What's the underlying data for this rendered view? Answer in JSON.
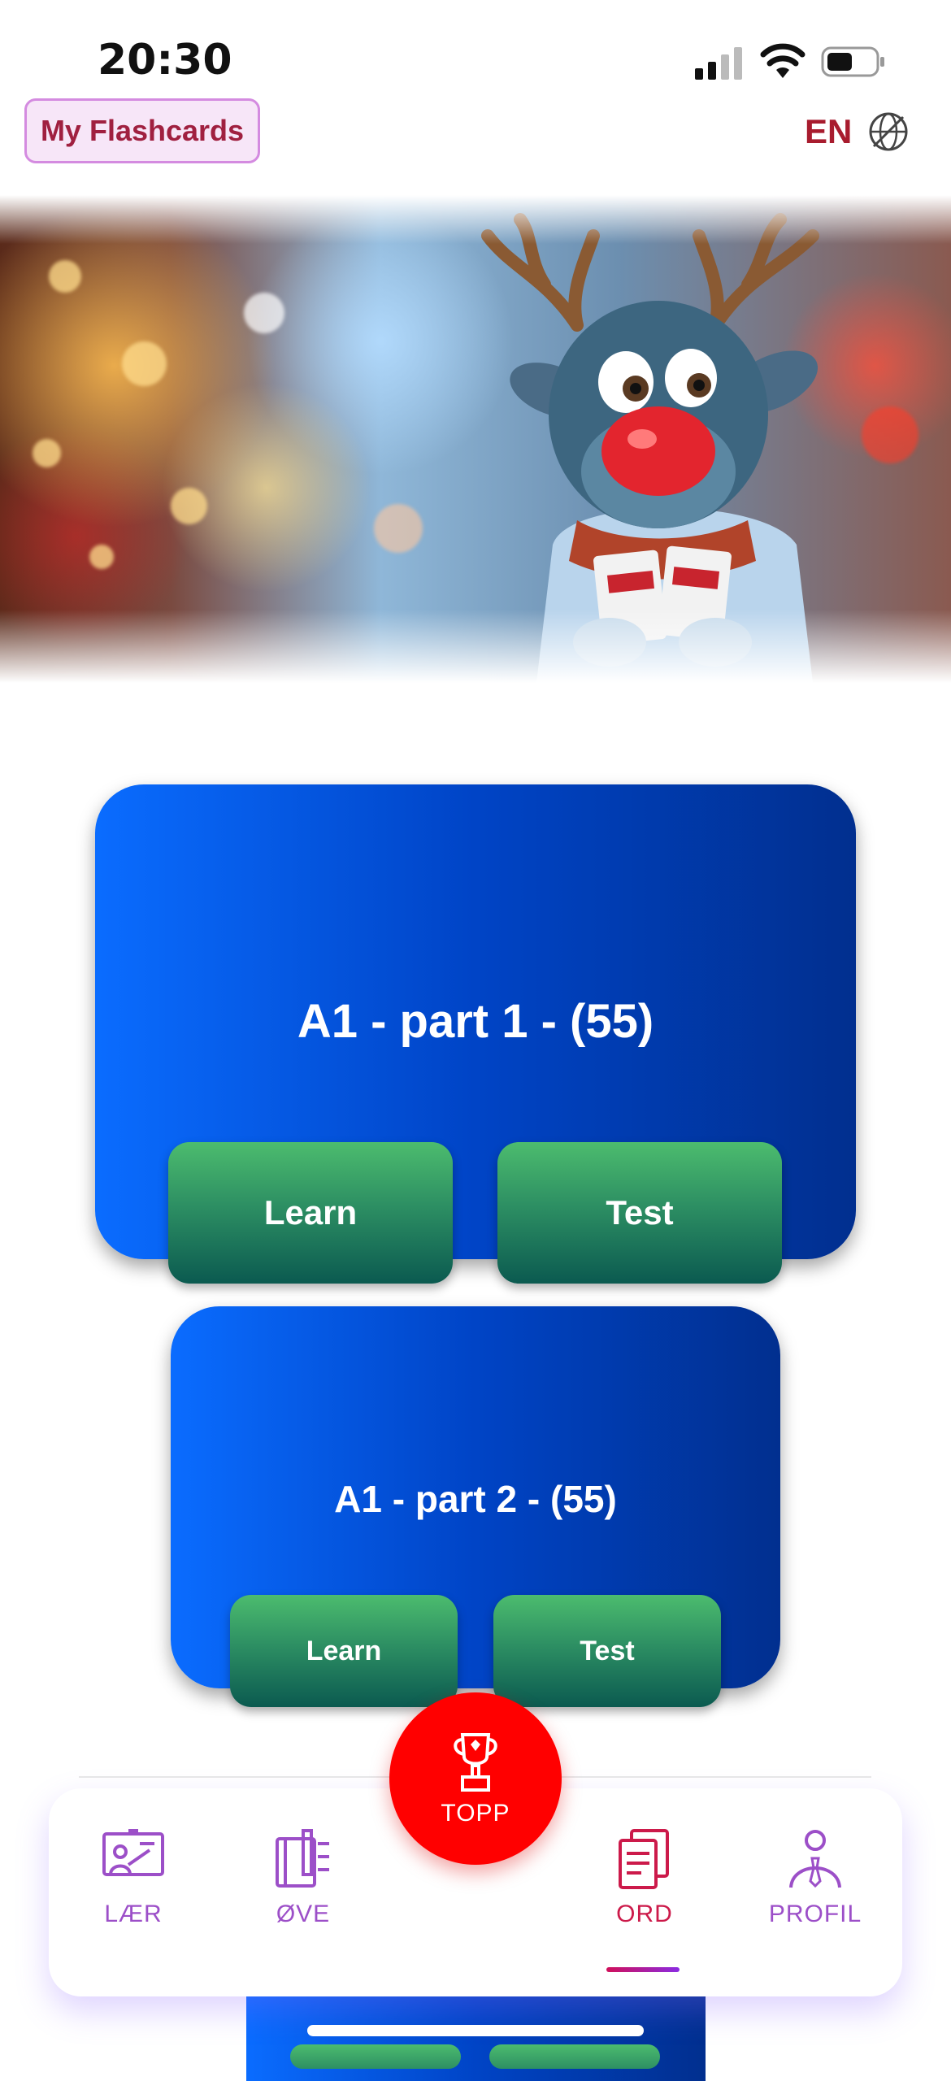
{
  "status_bar": {
    "time": "20:30"
  },
  "header": {
    "flashcards_label": "My Flashcards",
    "language_label": "EN",
    "language_icon": "globe-icon"
  },
  "banner": {
    "image": "reindeer-holding-card"
  },
  "cards": [
    {
      "title": "A1 - part 1 - (55)",
      "learn_label": "Learn",
      "test_label": "Test"
    },
    {
      "title": "A1 - part 2 - (55)",
      "learn_label": "Learn",
      "test_label": "Test"
    }
  ],
  "bottom_nav": {
    "items": [
      {
        "label": "LÆR",
        "icon": "teacher-board-icon",
        "active": false
      },
      {
        "label": "ØVE",
        "icon": "notebook-pen-icon",
        "active": false
      },
      {
        "label": "ORD",
        "icon": "documents-icon",
        "active": true
      },
      {
        "label": "PROFIL",
        "icon": "person-icon",
        "active": false
      }
    ],
    "center": {
      "label": "TOPP",
      "icon": "trophy-icon",
      "color": "#ff0000"
    }
  },
  "colors": {
    "card_gradient_start": "#0a6cff",
    "card_gradient_end": "#012f8f",
    "button_green": "#2d8f63",
    "nav_inactive": "#9c4fc8",
    "nav_active": "#cc1a4a"
  }
}
